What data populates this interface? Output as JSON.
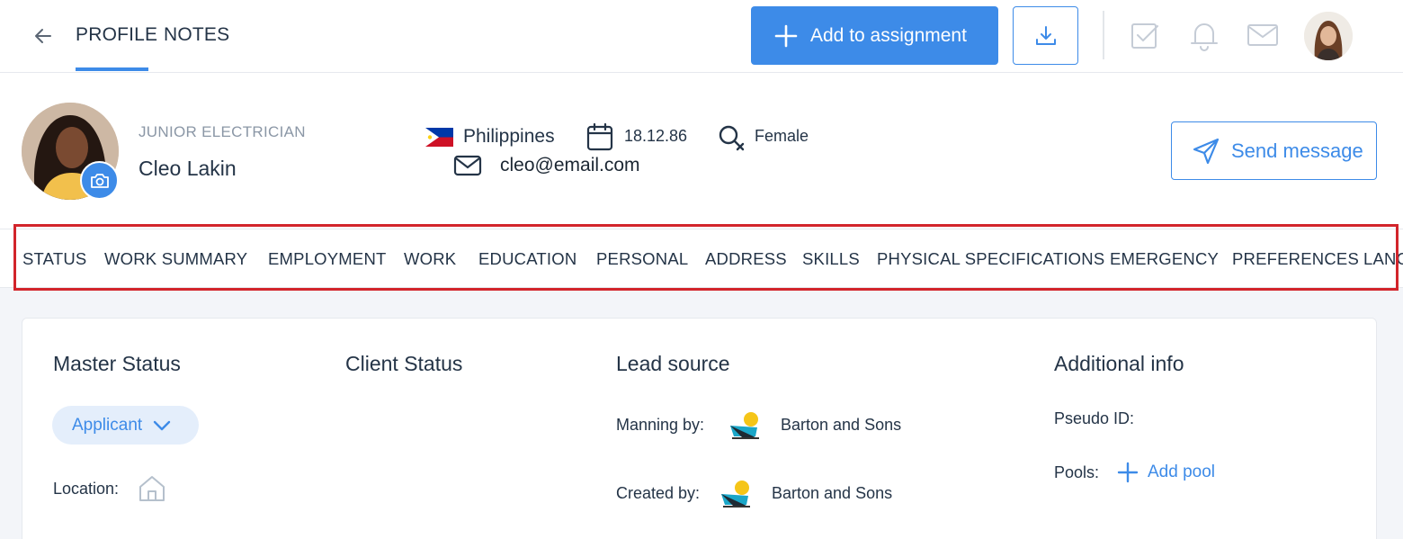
{
  "topbar": {
    "tabs": [
      "PROFILE",
      "NOTES"
    ],
    "add_button": "Add to assignment"
  },
  "profile": {
    "job_title": "JUNIOR ELECTRICIAN",
    "name": "Cleo Lakin",
    "country": "Philippines",
    "dob": "18.12.86",
    "gender": "Female",
    "email": "cleo@email.com",
    "send_button": "Send message"
  },
  "section_tabs": [
    "STATUS",
    "WORK SUMMARY",
    "EMPLOYMENT",
    "WORK",
    "EDUCATION",
    "PERSONAL",
    "ADDRESS",
    "SKILLS",
    "PHYSICAL SPECIFICATIONS",
    "EMERGENCY",
    "PREFERENCES",
    "LANG"
  ],
  "card": {
    "master_status": "Master Status",
    "status_value": "Applicant",
    "location_label": "Location:",
    "client_status": "Client Status",
    "lead_source": "Lead source",
    "manning_label": "Manning by:",
    "manning_value": "Barton and Sons",
    "created_label": "Created by:",
    "created_value": "Barton and Sons",
    "additional_info": "Additional info",
    "pseudo_id_label": "Pseudo ID:",
    "pools_label": "Pools:",
    "add_pool": "Add pool"
  },
  "colors": {
    "accent": "#3d8be8",
    "highlight": "#d2242b"
  }
}
